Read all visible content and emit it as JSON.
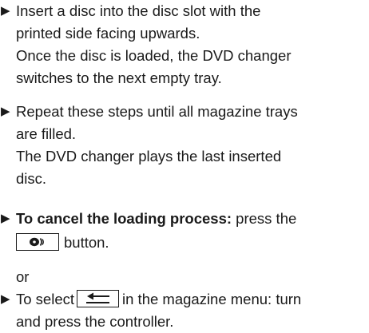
{
  "steps": [
    {
      "lines": [
        "Insert a disc into the disc slot with the",
        "printed side facing upwards.",
        "Once the disc is loaded, the DVD changer",
        "switches to the next empty tray."
      ]
    },
    {
      "lines": [
        "Repeat these steps until all magazine trays",
        "are filled.",
        "The DVD changer plays the last inserted",
        "disc."
      ]
    },
    {
      "bold_lead": "To cancel the loading process:",
      "after_bold": " press the",
      "line2_after_button": "button."
    },
    {
      "before_icon": "To select",
      "after_icon": "in the magazine menu: turn",
      "line2": "and press the controller."
    }
  ],
  "or_text": "or",
  "icons": {
    "bullet": "triangle-right-icon",
    "disc_button": "disc-eject-icon",
    "back_button": "back-arrow-icon"
  },
  "colors": {
    "text": "#1a1a1a",
    "background": "#ffffff"
  }
}
